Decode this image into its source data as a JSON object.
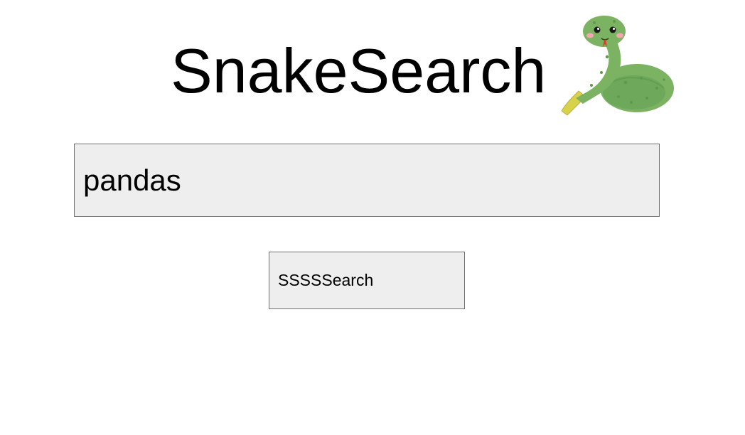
{
  "header": {
    "title": "SnakeSearch",
    "logo_icon": "snake-mascot-icon"
  },
  "search": {
    "value": "pandas",
    "button_label": "SSSSSearch"
  },
  "colors": {
    "input_background": "#eeeeee",
    "border": "#6f6f6f",
    "snake_green": "#7bb363",
    "snake_dark_green": "#5e9a4b",
    "snake_tail_yellow": "#d8d24a",
    "tongue_red": "#e03a2a",
    "cheek_pink": "#f4a6b0"
  }
}
